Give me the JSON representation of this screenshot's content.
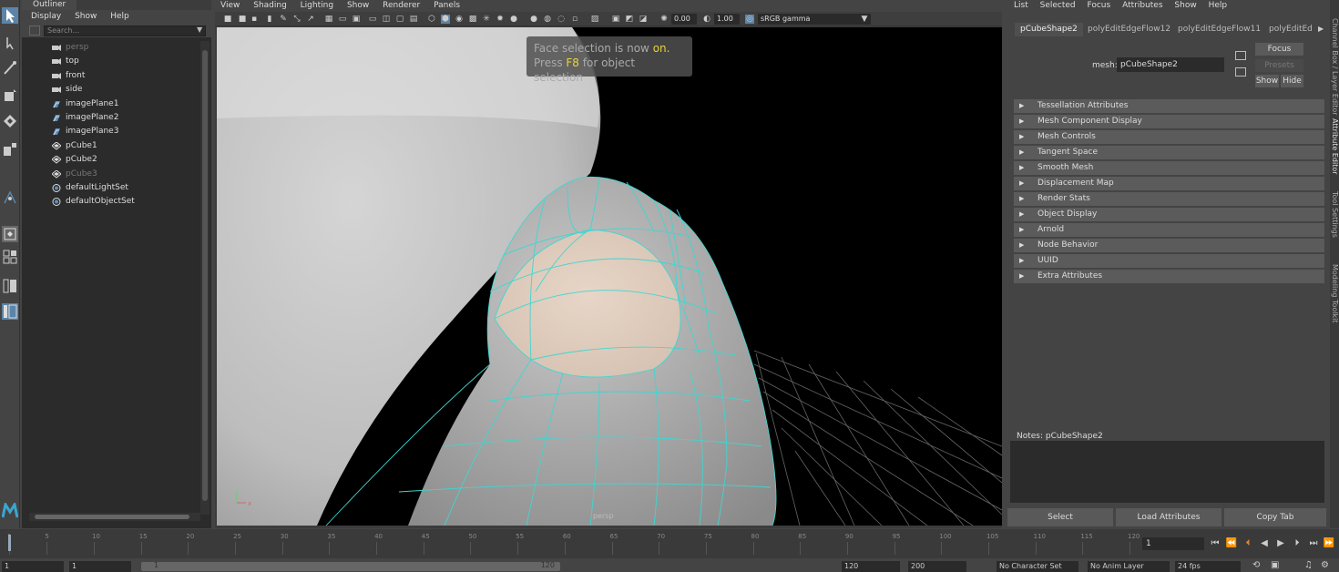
{
  "outliner": {
    "title": "Outliner",
    "menu": [
      "Display",
      "Show",
      "Help"
    ],
    "search_placeholder": "Search...",
    "items": [
      {
        "label": "persp",
        "kind": "camera",
        "dim": true
      },
      {
        "label": "top",
        "kind": "camera",
        "dim": false
      },
      {
        "label": "front",
        "kind": "camera",
        "dim": false
      },
      {
        "label": "side",
        "kind": "camera",
        "dim": false
      },
      {
        "label": "imagePlane1",
        "kind": "imageplane",
        "dim": false
      },
      {
        "label": "imagePlane2",
        "kind": "imageplane",
        "dim": false
      },
      {
        "label": "imagePlane3",
        "kind": "imageplane",
        "dim": false
      },
      {
        "label": "pCube1",
        "kind": "mesh",
        "dim": false
      },
      {
        "label": "pCube2",
        "kind": "mesh",
        "dim": false
      },
      {
        "label": "pCube3",
        "kind": "mesh",
        "dim": true
      },
      {
        "label": "defaultLightSet",
        "kind": "set",
        "dim": false
      },
      {
        "label": "defaultObjectSet",
        "kind": "set",
        "dim": false
      }
    ]
  },
  "viewport": {
    "menu": [
      "View",
      "Shading",
      "Lighting",
      "Show",
      "Renderer",
      "Panels"
    ],
    "exposure": "0.00",
    "gamma": "1.00",
    "color_space": "sRGB gamma",
    "hud_line1_prefix": "Face selection is now ",
    "hud_line1_on": "on.",
    "hud_line2_prefix": "Press ",
    "hud_line2_key": "F8",
    "hud_line2_suffix": " for object selection",
    "camera_label": "persp",
    "wire_color": "#3fd6d0"
  },
  "attribute_editor": {
    "menu": [
      "List",
      "Selected",
      "Focus",
      "Attributes",
      "Show",
      "Help"
    ],
    "tabs": [
      "pCubeShape2",
      "polyEditEdgeFlow12",
      "polyEditEdgeFlow11",
      "polyEditEd"
    ],
    "mesh_label": "mesh:",
    "mesh_value": "pCubeShape2",
    "focus_btn": "Focus",
    "presets_btn": "Presets",
    "show_btn": "Show",
    "hide_btn": "Hide",
    "sections": [
      "Tessellation Attributes",
      "Mesh Component Display",
      "Mesh Controls",
      "Tangent Space",
      "Smooth Mesh",
      "Displacement Map",
      "Render Stats",
      "Object Display",
      "Arnold",
      "Node Behavior",
      "UUID",
      "Extra Attributes"
    ],
    "notes_label": "Notes:  pCubeShape2",
    "select_btn": "Select",
    "load_btn": "Load Attributes",
    "copy_btn": "Copy Tab",
    "side_tabs": [
      "Channel Box / Layer Editor",
      "Attribute Editor",
      "Tool Settings",
      "Modeling Toolkit"
    ]
  },
  "timeline": {
    "ticks": [
      "1",
      "5",
      "10",
      "15",
      "20",
      "25",
      "30",
      "35",
      "40",
      "45",
      "50",
      "55",
      "60",
      "65",
      "70",
      "75",
      "80",
      "85",
      "90",
      "95",
      "100",
      "105",
      "110",
      "115",
      "120"
    ],
    "current_frame": "1"
  },
  "range": {
    "start": "1",
    "inner_start": "1",
    "slider_start": "1",
    "slider_end": "120",
    "end": "120",
    "outer_end": "200",
    "character_set": "No Character Set",
    "anim_layer": "No Anim Layer",
    "fps": "24 fps"
  }
}
